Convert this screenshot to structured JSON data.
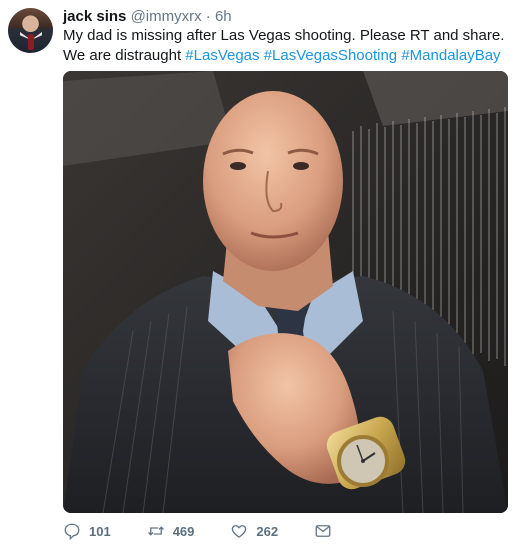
{
  "tweet": {
    "author_name": "jack sins",
    "author_handle": "@immyxrx",
    "separator": "·",
    "time": "6h",
    "text_plain": "My dad is missing after Las Vegas shooting. Please RT and share. We are distraught",
    "hashtags": [
      "#LasVegas",
      "#LasVegasShooting",
      "#MandalayBay"
    ]
  },
  "actions": {
    "replies": "101",
    "retweets": "469",
    "likes": "262"
  },
  "icons": {
    "reply": "reply-icon",
    "retweet": "retweet-icon",
    "like": "heart-icon",
    "dm": "envelope-icon"
  },
  "colors": {
    "hashtag": "#1b95e0",
    "secondary_text": "#657786"
  }
}
